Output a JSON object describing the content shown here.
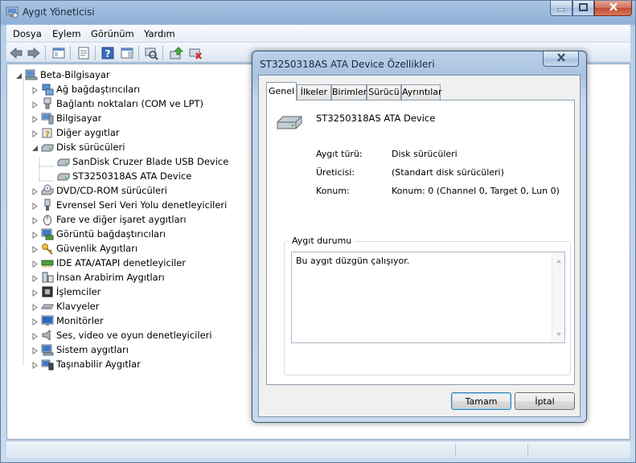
{
  "window": {
    "title": "Aygıt Yöneticisi"
  },
  "menu": [
    "Dosya",
    "Eylem",
    "Görünüm",
    "Yardım"
  ],
  "toolbar": {
    "icons": [
      "back-icon",
      "forward-icon",
      "properties-icon",
      "help-icon",
      "scan-hardware-icon",
      "update-driver-icon",
      "uninstall-icon"
    ]
  },
  "tree": {
    "root": "Beta-Bilgisayar",
    "items": [
      {
        "label": "Ağ bağdaştırıcıları",
        "icon": "network-adapter-icon"
      },
      {
        "label": "Bağlantı noktaları (COM ve LPT)",
        "icon": "port-icon"
      },
      {
        "label": "Bilgisayar",
        "icon": "computer-icon"
      },
      {
        "label": "Diğer aygıtlar",
        "icon": "unknown-device-icon"
      },
      {
        "label": "Disk sürücüleri",
        "icon": "disk-drive-icon",
        "expanded": true
      },
      {
        "label": "SanDisk Cruzer Blade USB Device",
        "icon": "disk-drive-icon",
        "child": true
      },
      {
        "label": "ST3250318AS ATA Device",
        "icon": "disk-drive-icon",
        "child": true
      },
      {
        "label": "DVD/CD-ROM sürücüleri",
        "icon": "dvd-drive-icon"
      },
      {
        "label": "Evrensel Seri Veri Yolu denetleyicileri",
        "icon": "usb-icon"
      },
      {
        "label": "Fare ve diğer işaret aygıtları",
        "icon": "mouse-icon"
      },
      {
        "label": "Görüntü bağdaştırıcıları",
        "icon": "display-adapter-icon"
      },
      {
        "label": "Güvenlik Aygıtları",
        "icon": "security-key-icon"
      },
      {
        "label": "IDE ATA/ATAPI denetleyiciler",
        "icon": "ide-controller-icon"
      },
      {
        "label": "İnsan Arabirim Aygıtları",
        "icon": "hid-icon"
      },
      {
        "label": "İşlemciler",
        "icon": "processor-icon"
      },
      {
        "label": "Klavyeler",
        "icon": "keyboard-icon"
      },
      {
        "label": "Monitörler",
        "icon": "monitor-icon"
      },
      {
        "label": "Ses, video ve oyun denetleyicileri",
        "icon": "speaker-icon"
      },
      {
        "label": "Sistem aygıtları",
        "icon": "system-device-icon"
      },
      {
        "label": "Taşınabilir Aygıtlar",
        "icon": "portable-device-icon"
      }
    ]
  },
  "dialog": {
    "title": "ST3250318AS ATA Device Özellikleri",
    "tabs": [
      "Genel",
      "İlkeler",
      "Birimler",
      "Sürücü",
      "Ayrıntılar"
    ],
    "active_tab": "Genel",
    "device_name": "ST3250318AS ATA Device",
    "properties": {
      "type_label": "Aygıt türü:",
      "type_value": "Disk sürücüleri",
      "manufacturer_label": "Üreticisi:",
      "manufacturer_value": "(Standart disk sürücüleri)",
      "location_label": "Konum:",
      "location_value": "Konum: 0 (Channel 0, Target 0, Lun 0)"
    },
    "status_group_title": "Aygıt durumu",
    "status_text": "Bu aygıt düzgün çalışıyor.",
    "ok_label": "Tamam",
    "cancel_label": "İptal"
  },
  "colors": {
    "title_bar": "#a9c4e3",
    "close_button": "#c04a30",
    "tree_line": "#a0a0a0"
  }
}
